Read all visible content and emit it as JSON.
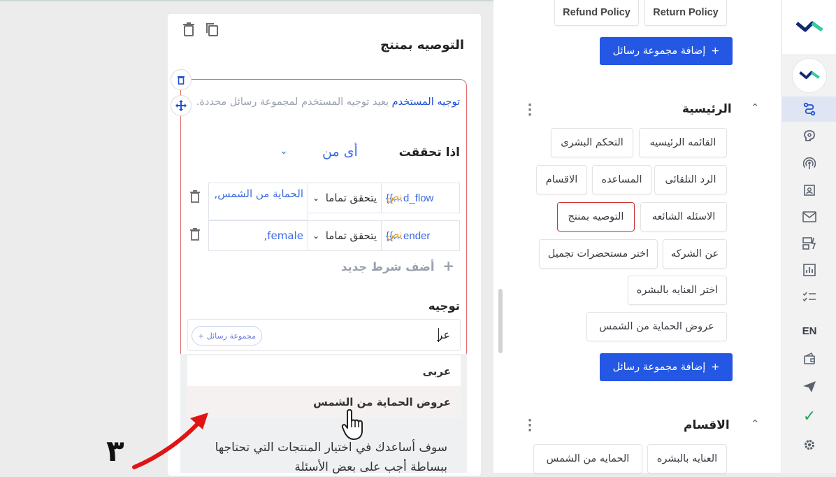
{
  "menus": {
    "top_chips": [
      "Refund Policy",
      "Return Policy"
    ],
    "add_group_label": "إضافة مجموعة رسائل",
    "add_plus": "+",
    "main_section": {
      "title": "الرئيسية",
      "chips": [
        "القائمه الرئيسيه",
        "التحكم البشرى",
        "الرد التلقائى",
        "المساعده",
        "الاقسام",
        "الاسئله الشائعه",
        "التوصيه بمنتج",
        "عن الشركه",
        "اختر مستحضرات تجميل",
        "اختر العنايه بالبشره",
        "عروض الحماية من الشمس"
      ]
    },
    "sections_section": {
      "title": "الاقسام",
      "chips": [
        "العنايه بالبشره",
        "الحمايه من الشمس"
      ]
    }
  },
  "rail": {
    "items": [
      "flow-icon",
      "brain-icon",
      "broadcast-icon",
      "contact-card-icon",
      "mail-icon",
      "form-icon",
      "chart-icon",
      "checklist-icon",
      "EN",
      "wallet-icon",
      "send-icon",
      "check-icon",
      "gear-icon"
    ],
    "en_label": "EN",
    "accent": "#1f4fd6",
    "brand": "#0e2a72",
    "brand_accent": "#2fd0a0"
  },
  "card": {
    "title": "التوصيه بمنتج",
    "description_link": "توجيه المستخدم",
    "description_rest": " يعيد توجيه المستخدم لمجموعة رسائل محددة.",
    "if_label": "اذا تحققت",
    "any_of": "أى من",
    "conditions": [
      {
        "variable": "{{…d_flow",
        "type": "نص",
        "operator": "يتحقق تماما",
        "value": "الحماية من الشمس,"
      },
      {
        "variable": "{{…ender",
        "type": "نص",
        "operator": "يتحقق تماما",
        "value": "female,"
      }
    ],
    "add_condition": "أضف شرط جديد",
    "redirect_label": "توجيه",
    "redirect_input_value": "عر",
    "message_group_chip": "+ مجموعة رسائل",
    "dropdown": {
      "items": [
        "عربى",
        "عروض الحماية من الشمس"
      ],
      "preview": "سوف أساعدك في اختيار المنتجات التي تحتاجها ببساطة أجب على بعض الأسئلة"
    }
  },
  "annotation": {
    "number": "٣",
    "arrow_color": "#e01414"
  }
}
